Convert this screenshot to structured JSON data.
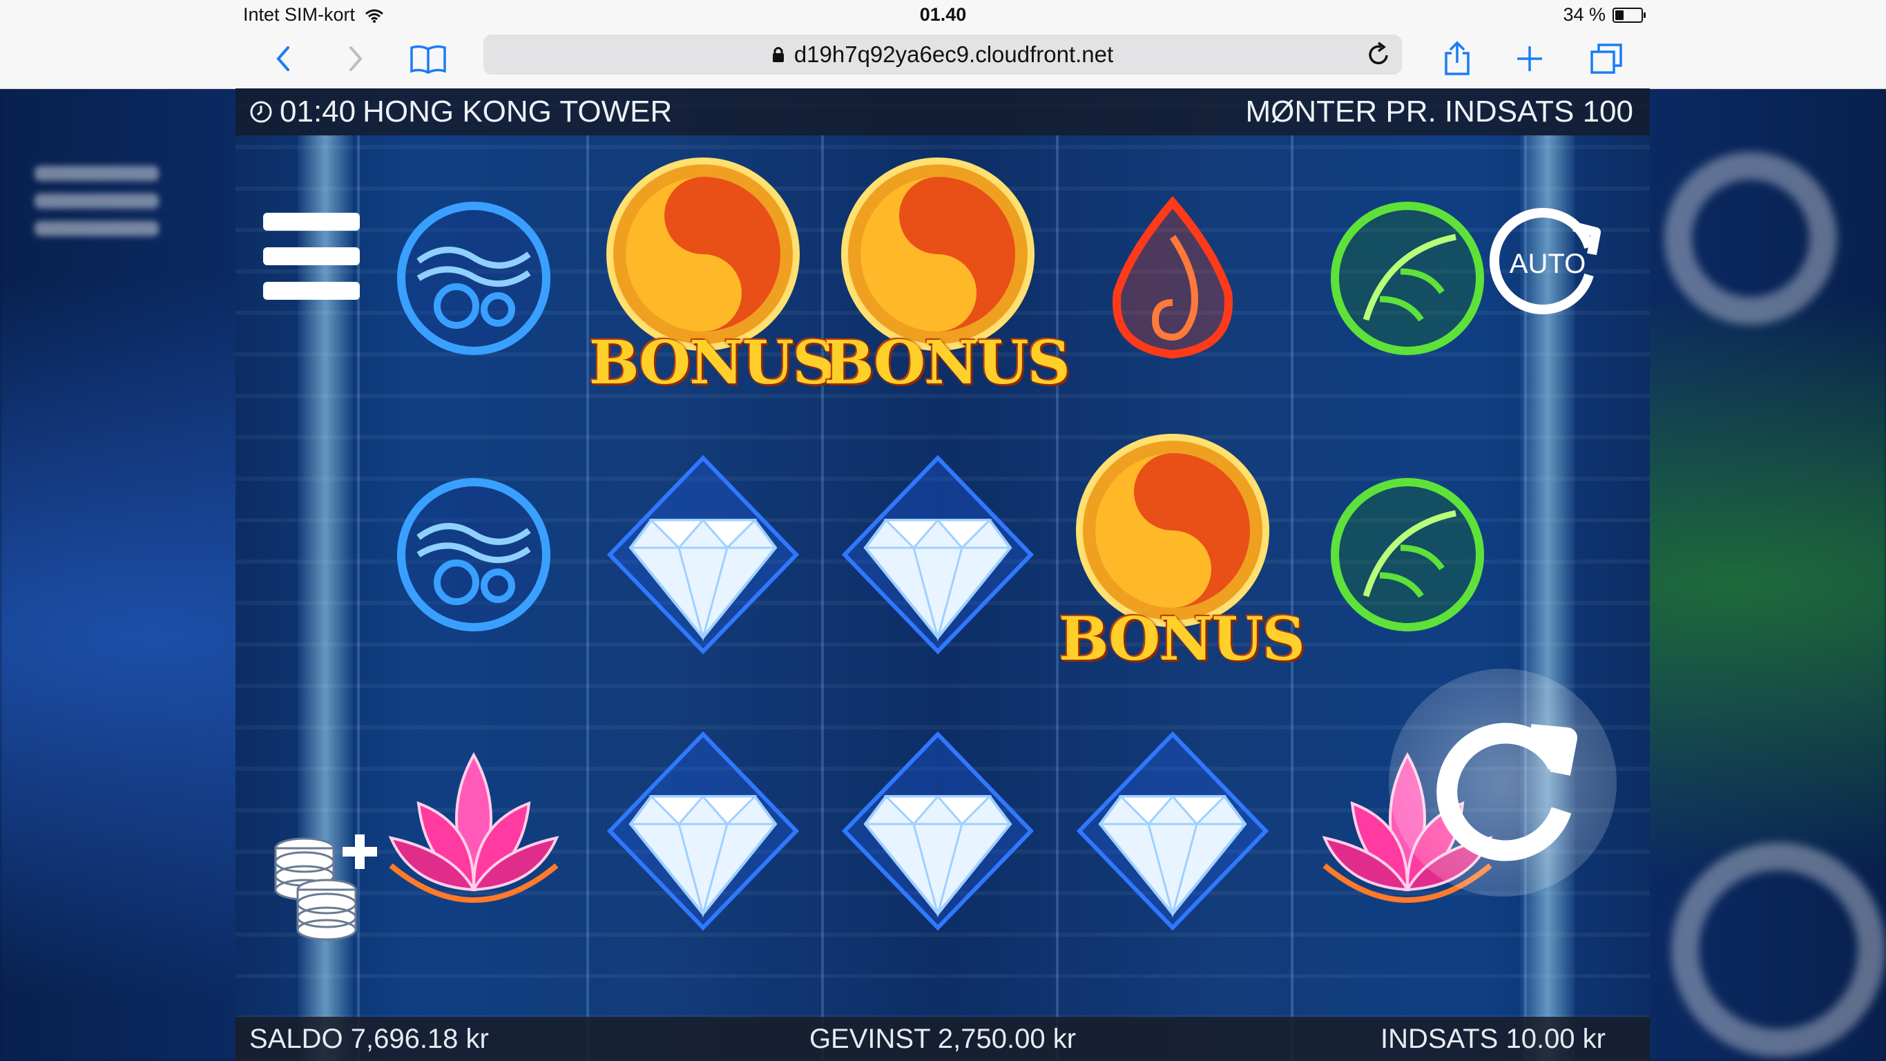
{
  "status_bar": {
    "carrier": "Intet SIM-kort",
    "time": "01.40",
    "battery": "34 %",
    "battery_level": 0.34
  },
  "browser": {
    "url": "d19h7q92ya6ec9.cloudfront.net"
  },
  "game": {
    "clock": "01:40",
    "title": "HONG KONG TOWER",
    "coins_per_bet": "MØNTER PR. INDSATS 100",
    "auto_label": "AUTO",
    "bonus_label": "BONUS",
    "saldo": "SALDO 7,696.18 kr",
    "gevinst": "GEVINST 2,750.00 kr",
    "indsats": "INDSATS 10.00 kr",
    "reels": [
      [
        "water",
        "water",
        "lotus"
      ],
      [
        "bonus",
        "diamond",
        "diamond"
      ],
      [
        "bonus",
        "diamond",
        "diamond"
      ],
      [
        "fire",
        "bonus",
        "diamond"
      ],
      [
        "leaf",
        "leaf",
        "lotus"
      ]
    ]
  },
  "colors": {
    "bonus_gold": "#ffcf2a",
    "water_blue": "#3aa0ff",
    "fire_red": "#ff3a1a",
    "leaf_green": "#5ee23a",
    "lotus_pink": "#ff5ab8"
  }
}
